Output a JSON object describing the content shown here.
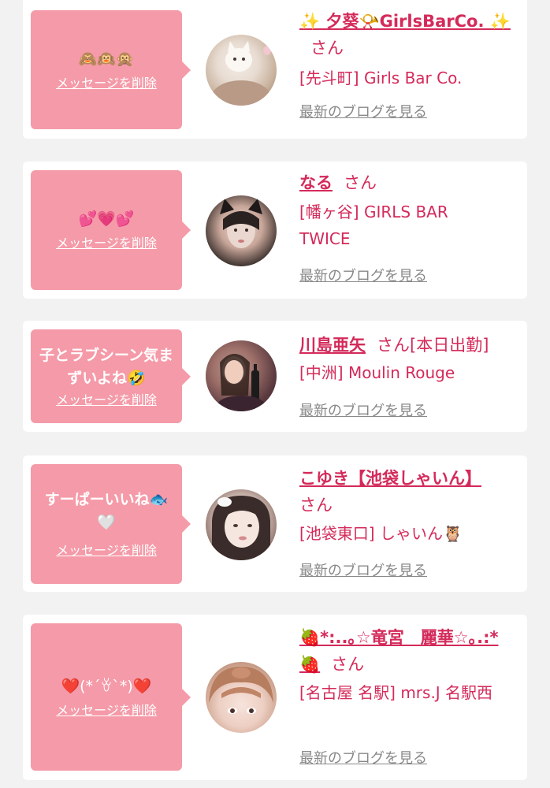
{
  "colors": {
    "background": "#f2f2f2",
    "card": "#ffffff",
    "bubble": "#f59aa8",
    "accent": "#d42a5a",
    "link_gray": "#888888"
  },
  "delete_label": "メッセージを削除",
  "blog_label": "最新のブログを見る",
  "san_label": "さん",
  "entries": [
    {
      "message": "🙈🙉🙊",
      "name": "✨ 夕葵📯GirlsBarCo. ✨",
      "suffix": "",
      "shop": "[先斗町] Girls Bar Co.",
      "avatar_icon": "avatar-photo"
    },
    {
      "message": "💕💗💕",
      "name": "なる",
      "suffix": "",
      "shop": "[幡ヶ谷] GIRLS BAR TWICE",
      "avatar_icon": "avatar-photo"
    },
    {
      "message": "子とラブシーン気まずいよね🤣",
      "name": "川島亜矢",
      "suffix": "[本日出勤]",
      "shop": "[中洲] Moulin Rouge",
      "avatar_icon": "avatar-photo"
    },
    {
      "message": "すーぱーいいね🐟🤍",
      "name": "こゆき【池袋しゃいん】",
      "suffix": "",
      "shop": "[池袋東口] しゃいん🦉",
      "avatar_icon": "avatar-photo"
    },
    {
      "message": "❤️(*´ꈊ`*)❤️",
      "name": "🍓*:..｡☆竜宮　麗華☆｡.:*🍓",
      "suffix": "",
      "shop": "[名古屋 名駅] mrs.J 名駅西",
      "avatar_icon": "avatar-photo"
    }
  ]
}
